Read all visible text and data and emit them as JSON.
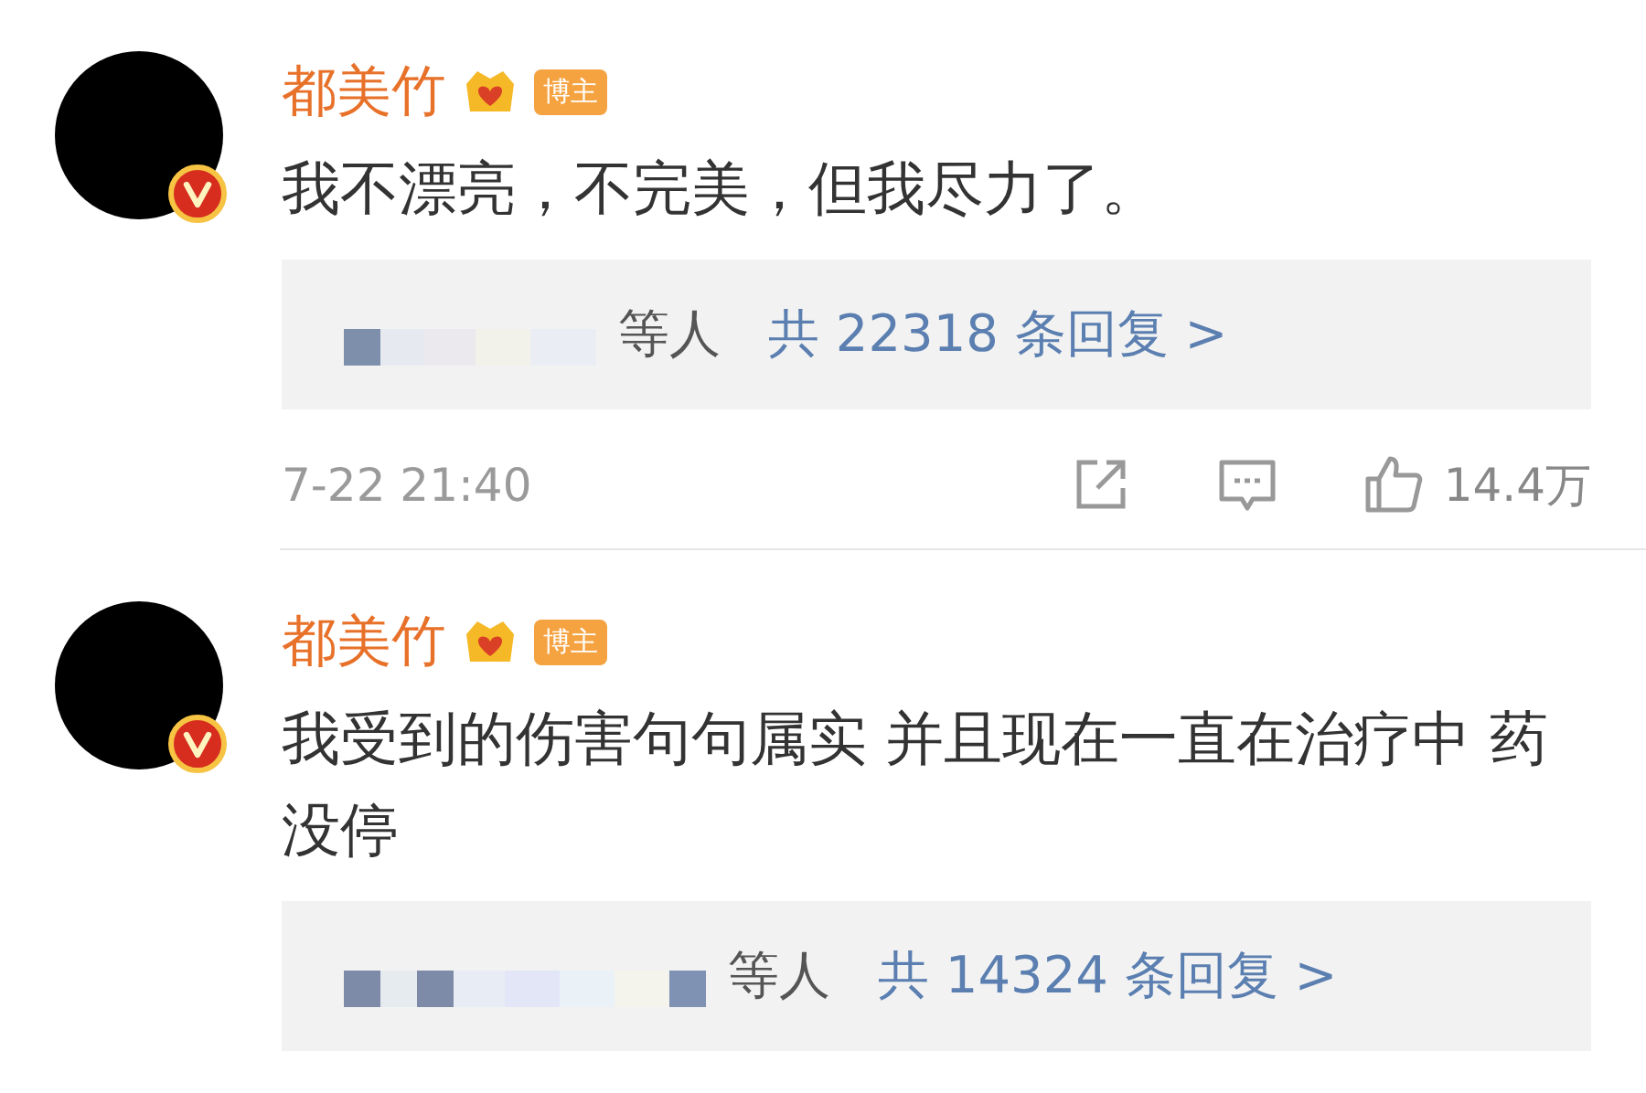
{
  "comments": [
    {
      "author": "都美竹",
      "badge": "博主",
      "text": "我不漂亮，不完美，但我尽力了。",
      "replies": {
        "suffix": "等人",
        "link": "共 22318 条回复 >"
      },
      "time": "7-22 21:40",
      "likes": "14.4万"
    },
    {
      "author": "都美竹",
      "badge": "博主",
      "text": "我受到的伤害句句属实 并且现在一直在治疗中 药没停",
      "replies": {
        "suffix": "等人",
        "link": "共 14324 条回复 >"
      }
    }
  ]
}
